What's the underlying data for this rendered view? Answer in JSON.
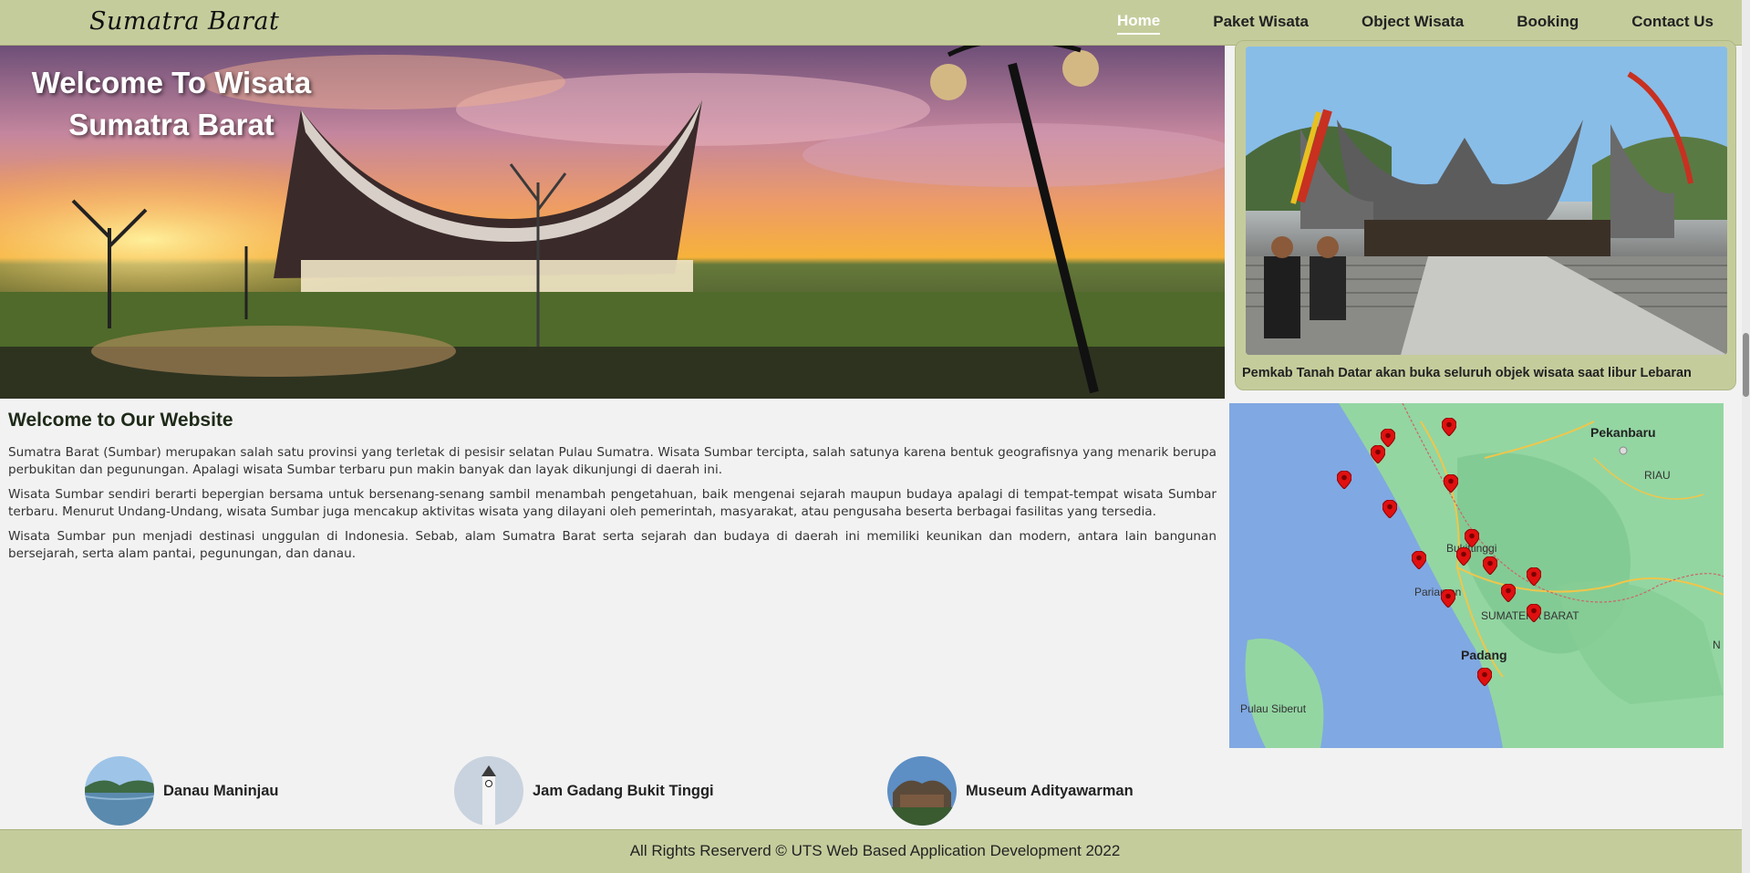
{
  "nav": {
    "brand": "Sumatra Barat",
    "items": [
      {
        "label": "Home",
        "active": true
      },
      {
        "label": "Paket Wisata",
        "active": false
      },
      {
        "label": "Object Wisata",
        "active": false
      },
      {
        "label": "Booking",
        "active": false
      },
      {
        "label": "Contact Us",
        "active": false
      }
    ]
  },
  "hero": {
    "title_line1": "Welcome To Wisata",
    "title_line2": "Sumatra Barat"
  },
  "news": {
    "caption": "Pemkab Tanah Datar akan buka seluruh objek wisata saat libur Lebaran"
  },
  "about": {
    "heading": "Welcome to Our Website",
    "paragraphs": [
      "Sumatra Barat (Sumbar) merupakan salah satu provinsi yang terletak di pesisir selatan Pulau Sumatra. Wisata Sumbar tercipta, salah satunya karena bentuk geografisnya yang menarik berupa perbukitan dan pegunungan. Apalagi wisata Sumbar terbaru pun makin banyak dan layak dikunjungi di daerah ini.",
      "Wisata Sumbar sendiri berarti bepergian bersama untuk bersenang-senang sambil menambah pengetahuan, baik mengenai sejarah maupun budaya apalagi di tempat-tempat wisata Sumbar terbaru. Menurut Undang-Undang, wisata Sumbar juga mencakup aktivitas wisata yang dilayani oleh pemerintah, masyarakat, atau pengusaha beserta berbagai fasilitas yang tersedia.",
      "Wisata Sumbar pun menjadi destinasi unggulan di Indonesia. Sebab, alam Sumatra Barat serta sejarah dan budaya di daerah ini memiliki keunikan dan modern, antara lain bangunan bersejarah, serta alam pantai, pegunungan, dan danau."
    ]
  },
  "map": {
    "labels": {
      "pekanbaru": "Pekanbaru",
      "riau": "RIAU",
      "bukittinggi": "Bukittinggi",
      "pariaman": "Pariaman",
      "sumbar": "SUMATERA BARAT",
      "padang": "Padang",
      "siberut": "Pulau Siberut",
      "edge": "N"
    }
  },
  "places": [
    {
      "name": "Danau Maninjau",
      "icon": "lake-photo"
    },
    {
      "name": "Jam Gadang Bukit Tinggi",
      "icon": "clock-tower-photo"
    },
    {
      "name": "Museum Adityawarman",
      "icon": "museum-photo"
    }
  ],
  "footer": {
    "text": "All Rights Reserverd © UTS Web Based Application Development 2022"
  },
  "colors": {
    "nav_bg": "#c5cc9c",
    "page_bg": "#f2f2f2",
    "map_land": "#93d6a2",
    "map_sea": "#7fa8e0",
    "pin": "#e01010"
  }
}
